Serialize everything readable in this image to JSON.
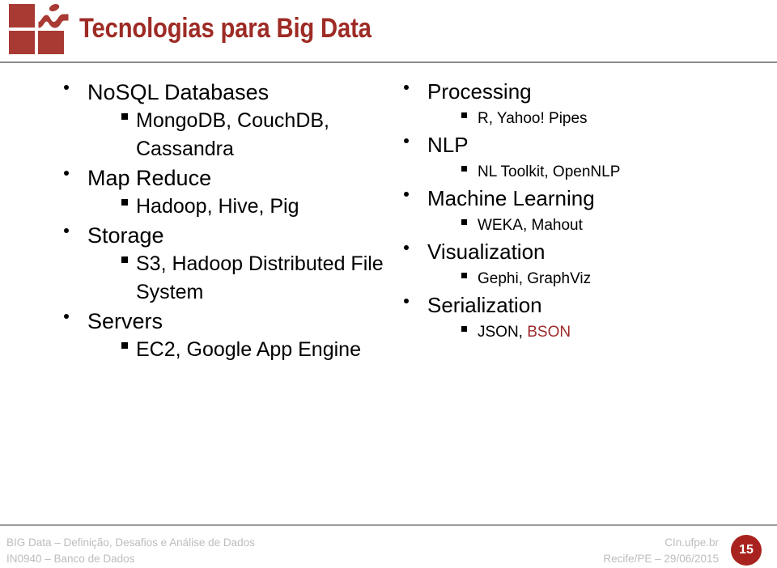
{
  "slide": {
    "title": "Tecnologias para Big Data",
    "logo_icon": "cin-ufpe-logo-icon",
    "accent_color": "#9e2b25",
    "logo_color": "#a83a33"
  },
  "columns": [
    {
      "id": "left",
      "groups": [
        {
          "label": "NoSQL Databases",
          "items": [
            "MongoDB, CouchDB, Cassandra"
          ]
        },
        {
          "label": "Map Reduce",
          "items": [
            "Hadoop, Hive, Pig"
          ]
        },
        {
          "label": "Storage",
          "items": [
            "S3, Hadoop Distributed File System"
          ]
        },
        {
          "label": "Servers",
          "items": [
            "EC2, Google App Engine"
          ]
        }
      ]
    },
    {
      "id": "right",
      "groups": [
        {
          "label": "Processing",
          "items": [
            "R, Yahoo! Pipes"
          ]
        },
        {
          "label": "NLP",
          "items": [
            "NL Toolkit, OpenNLP"
          ]
        },
        {
          "label": "Machine Learning",
          "items": [
            "WEKA, Mahout"
          ]
        },
        {
          "label": "Visualization",
          "items": [
            "Gephi, GraphViz"
          ]
        },
        {
          "label": "Serialization",
          "items": [
            "JSON, BSON"
          ],
          "highlight": "BSON",
          "highlight_color": "#9e2b2b"
        }
      ]
    }
  ],
  "footer": {
    "line1": "BIG Data – Definição, Desafios e Análise de Dados",
    "line2": "IN0940 – Banco de Dados",
    "right_line1": "CIn.ufpe.br",
    "right_line2": "Recife/PE – 29/06/2015",
    "page_number": "15",
    "text_color": "#bdbdbd",
    "badge_color": "#a8231f"
  }
}
